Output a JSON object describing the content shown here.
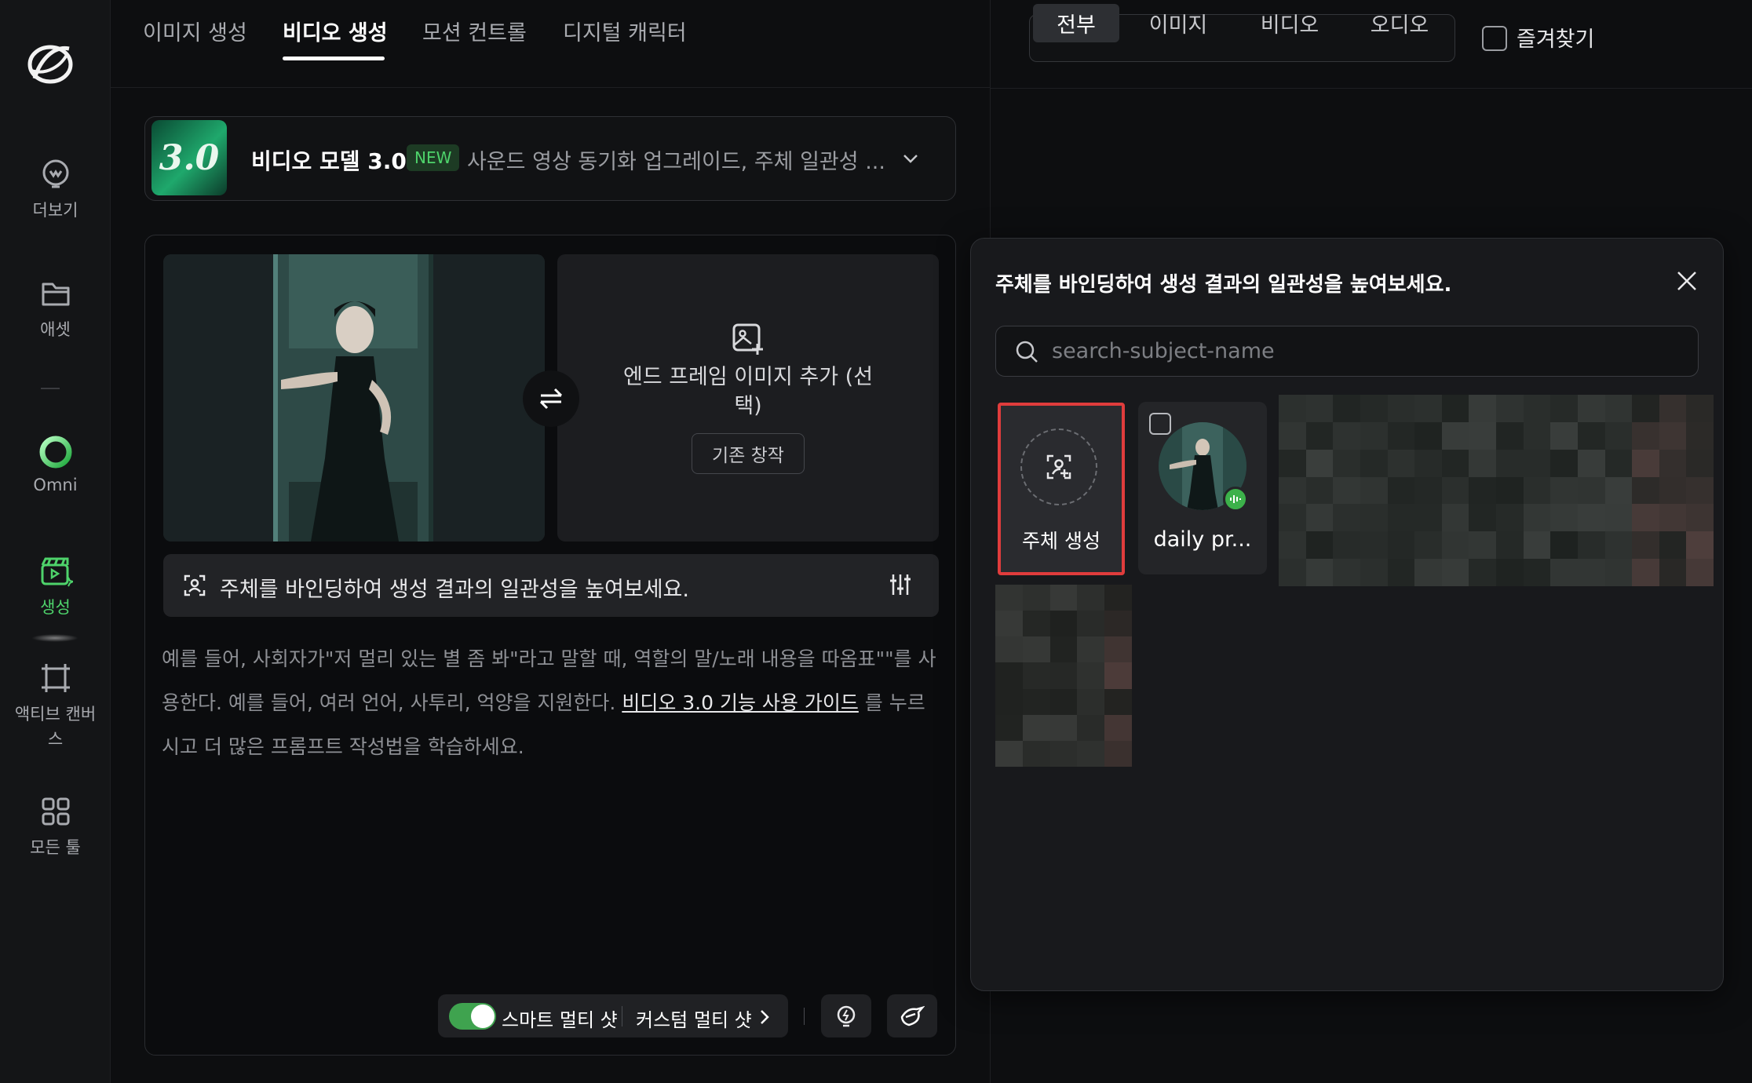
{
  "sidebar": {
    "items": [
      {
        "label": "더보기",
        "icon": "lightbulb-icon"
      },
      {
        "label": "애셋",
        "icon": "folder-icon"
      },
      {
        "label": "Omni",
        "icon": "omni-ring-icon"
      },
      {
        "label": "생성",
        "icon": "clapperboard-icon",
        "active": true
      },
      {
        "label": "액티브 캔버스",
        "icon": "canvas-frame-icon"
      },
      {
        "label": "모든 툴",
        "icon": "grid-icon"
      }
    ]
  },
  "tabs": [
    {
      "label": "이미지 생성"
    },
    {
      "label": "비디오 생성",
      "active": true
    },
    {
      "label": "모션 컨트롤"
    },
    {
      "label": "디지털 캐릭터"
    }
  ],
  "filters": {
    "options": [
      "전부",
      "이미지",
      "비디오",
      "오디오"
    ],
    "selected": "전부",
    "favorites_label": "즐겨찾기"
  },
  "model": {
    "badge_text": "3.0",
    "name": "비디오 모델 3.0",
    "tag": "NEW",
    "description": "사운드 영상 동기화 업그레이드, 주체 일관성 ..."
  },
  "frames": {
    "end_frame_label": "엔드 프레임 이미지 추가 (선택)",
    "existing_button": "기존 창작"
  },
  "bind_bar": {
    "text": "주체를 바인딩하여 생성 결과의 일관성을 높여보세요."
  },
  "prompt": {
    "text_before": "예를 들어, 사회자가\"저 멀리 있는 별 좀 봐\"라고 말할 때, 역할의 말/노래 내용을 따옴표\"\"를 사용한다. 예를 들어, 여러 언어, 사투리, 억양을 지원한다. ",
    "link": "비디오 3.0 기능 사용 가이드",
    "text_after": " 를 누르시고 더 많은 프롬프트 작성법을 학습하세요."
  },
  "toolbar": {
    "smart_multishot": "스마트 멀티 샷",
    "smart_multishot_on": true,
    "custom_multishot": "커스텀 멀티 샷"
  },
  "subject_popup": {
    "title": "주체를 바인딩하여 생성 결과의 일관성을 높여보세요.",
    "search_placeholder": "search-subject-name",
    "create_label": "주체 생성",
    "subjects": [
      {
        "label": "daily pr...",
        "has_audio": true
      }
    ]
  },
  "colors": {
    "accent": "#4ed36b",
    "highlight_border": "#e03c3c",
    "background": "#0d0e10"
  }
}
